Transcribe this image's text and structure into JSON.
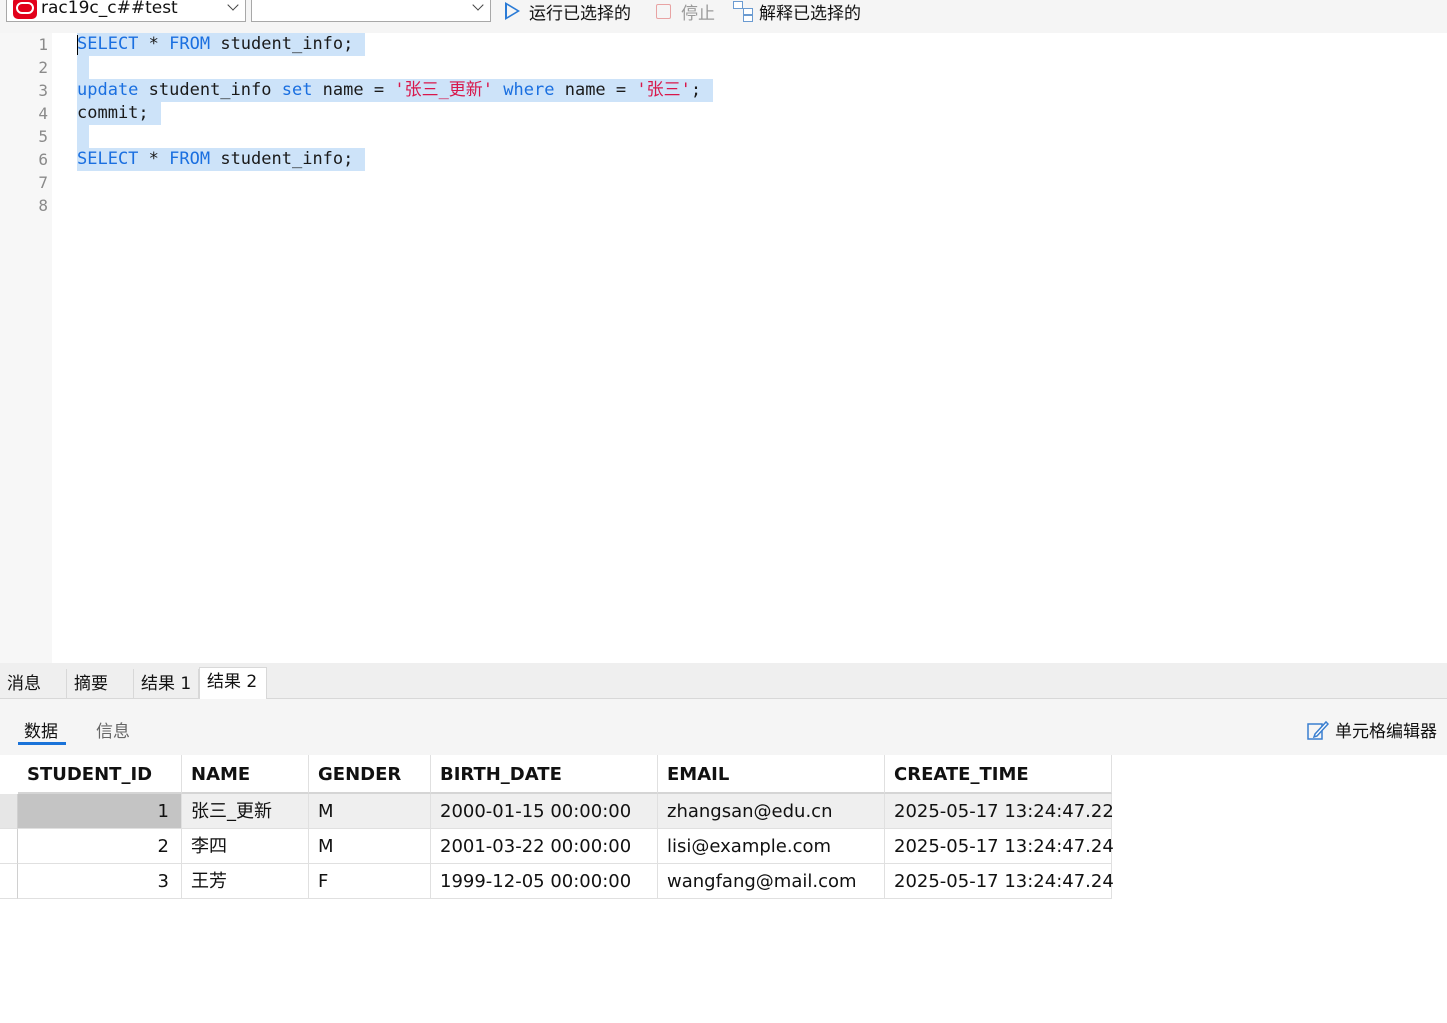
{
  "toolbar": {
    "connection": "rac19c_c##test",
    "schema": "",
    "run_selected": "运行已选择的",
    "stop": "停止",
    "explain_selected": "解释已选择的"
  },
  "editor": {
    "line_numbers": [
      "1",
      "2",
      "3",
      "4",
      "5",
      "6",
      "7",
      "8"
    ],
    "lines": [
      {
        "parts": [
          [
            "kw",
            "SELECT"
          ],
          [
            "",
            " * "
          ],
          [
            "kw",
            "FROM"
          ],
          [
            "",
            " student_info;"
          ]
        ]
      },
      {
        "parts": []
      },
      {
        "parts": [
          [
            "kw",
            "update"
          ],
          [
            "",
            " student_info "
          ],
          [
            "kw",
            "set"
          ],
          [
            "",
            " name = "
          ],
          [
            "str",
            "'张三_更新'"
          ],
          [
            "",
            " "
          ],
          [
            "kw",
            "where"
          ],
          [
            "",
            " name = "
          ],
          [
            "str",
            "'张三'"
          ],
          [
            "",
            ";"
          ]
        ]
      },
      {
        "parts": [
          [
            "",
            "commit;"
          ]
        ]
      },
      {
        "parts": []
      },
      {
        "parts": [
          [
            "kw",
            "SELECT"
          ],
          [
            "",
            " * "
          ],
          [
            "kw",
            "FROM"
          ],
          [
            "",
            " student_info;"
          ]
        ]
      },
      {
        "parts": []
      },
      {
        "parts": []
      }
    ]
  },
  "result_tabs": [
    "消息",
    "摘要",
    "结果 1",
    "结果 2"
  ],
  "active_result_tab": "结果 2",
  "sub_tabs": [
    "数据",
    "信息"
  ],
  "active_sub_tab": "数据",
  "cell_editor_label": "单元格编辑器",
  "grid": {
    "columns": [
      "STUDENT_ID",
      "NAME",
      "GENDER",
      "BIRTH_DATE",
      "EMAIL",
      "CREATE_TIME"
    ],
    "rows": [
      [
        "1",
        "张三_更新",
        "M",
        "2000-01-15 00:00:00",
        "zhangsan@edu.cn",
        "2025-05-17 13:24:47.22"
      ],
      [
        "2",
        "李四",
        "M",
        "2001-03-22 00:00:00",
        "lisi@example.com",
        "2025-05-17 13:24:47.24"
      ],
      [
        "3",
        "王芳",
        "F",
        "1999-12-05 00:00:00",
        "wangfang@mail.com",
        "2025-05-17 13:24:47.24"
      ]
    ]
  },
  "colors": {
    "keyword": "#1a6fe0",
    "string": "#d8174b",
    "selection": "#cde3f9",
    "accent": "#1a73d9"
  }
}
